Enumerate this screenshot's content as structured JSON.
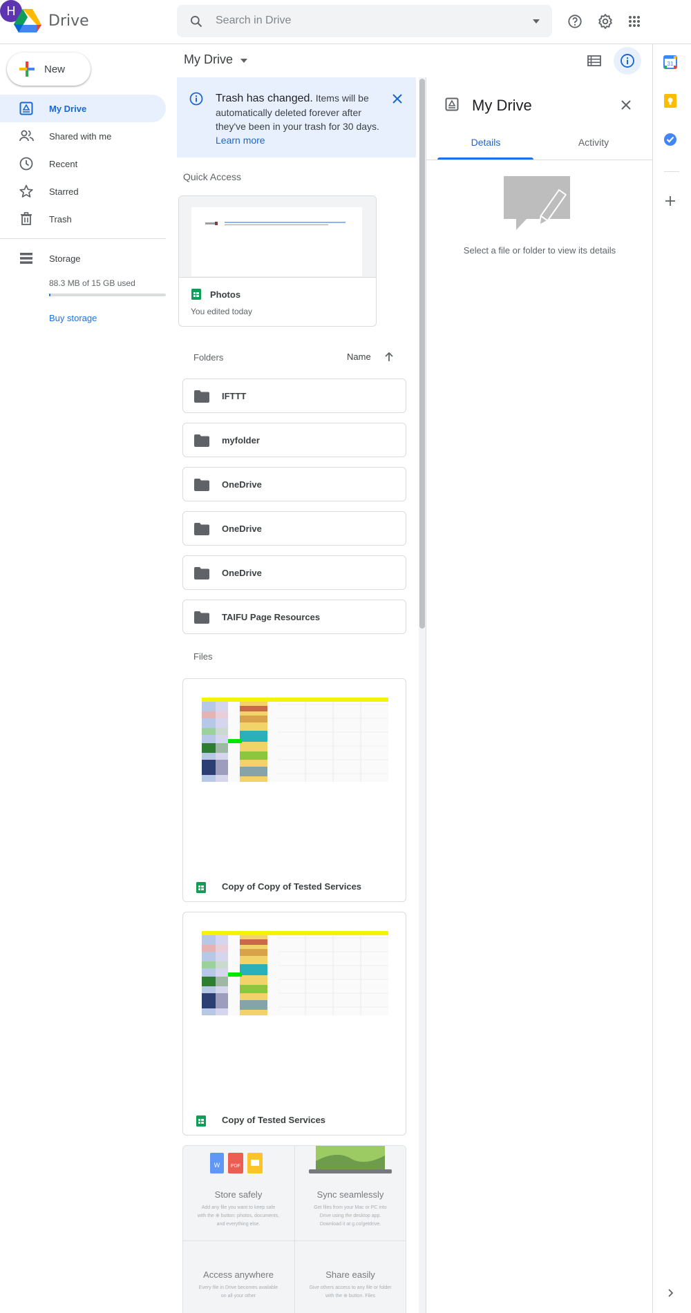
{
  "header": {
    "app_name": "Drive",
    "search_placeholder": "Search in Drive",
    "avatar_letter": "H"
  },
  "sidebar": {
    "new_label": "New",
    "items": [
      {
        "label": "My Drive",
        "icon": "my-drive-icon",
        "active": true
      },
      {
        "label": "Shared with me",
        "icon": "people-icon",
        "active": false
      },
      {
        "label": "Recent",
        "icon": "clock-icon",
        "active": false
      },
      {
        "label": "Starred",
        "icon": "star-icon",
        "active": false
      },
      {
        "label": "Trash",
        "icon": "trash-icon",
        "active": false
      }
    ],
    "storage_label": "Storage",
    "storage_used": "88.3 MB of 15 GB used",
    "storage_fraction": 0.006,
    "buy_storage": "Buy storage"
  },
  "toolbar": {
    "title": "My Drive"
  },
  "banner": {
    "heading": "Trash has changed.",
    "body": " Items will be automatically deleted forever after they've been in your trash for 30 days. ",
    "link": "Learn more"
  },
  "quick_access": {
    "section_label": "Quick Access",
    "card": {
      "name": "Photos",
      "subtitle": "You edited today",
      "icon": "sheets-icon"
    }
  },
  "folders": {
    "section_label": "Folders",
    "sort_label": "Name",
    "items": [
      "IFTTT",
      "myfolder",
      "OneDrive",
      "OneDrive",
      "OneDrive",
      "TAIFU Page Resources"
    ]
  },
  "files": {
    "section_label": "Files",
    "items": [
      {
        "name": "Copy of Copy of Tested Services",
        "icon": "sheets-icon"
      },
      {
        "name": "Copy of Tested Services",
        "icon": "sheets-icon"
      }
    ]
  },
  "promo": {
    "tiles": [
      {
        "title": "Store safely",
        "desc": "Add any file you want to keep safe with the ⊕ button: photos, documents, and everything else."
      },
      {
        "title": "Sync seamlessly",
        "desc": "Get files from your Mac or PC into Drive using the desktop app. Download it at g.co/getdrive."
      },
      {
        "title": "Access anywhere",
        "desc": "Every file in Drive becomes available on all your other"
      },
      {
        "title": "Share easily",
        "desc": "Give others access to any file or folder with the ⊕ button. Files"
      }
    ]
  },
  "details": {
    "title": "My Drive",
    "tabs": [
      "Details",
      "Activity"
    ],
    "active_tab": "Details",
    "empty_message": "Select a file or folder to view its details"
  },
  "colors": {
    "accent": "#1a73e8",
    "active_nav_bg": "#e8f0fe",
    "avatar": "#5e35b1",
    "sheets_green": "#0f9d58"
  }
}
